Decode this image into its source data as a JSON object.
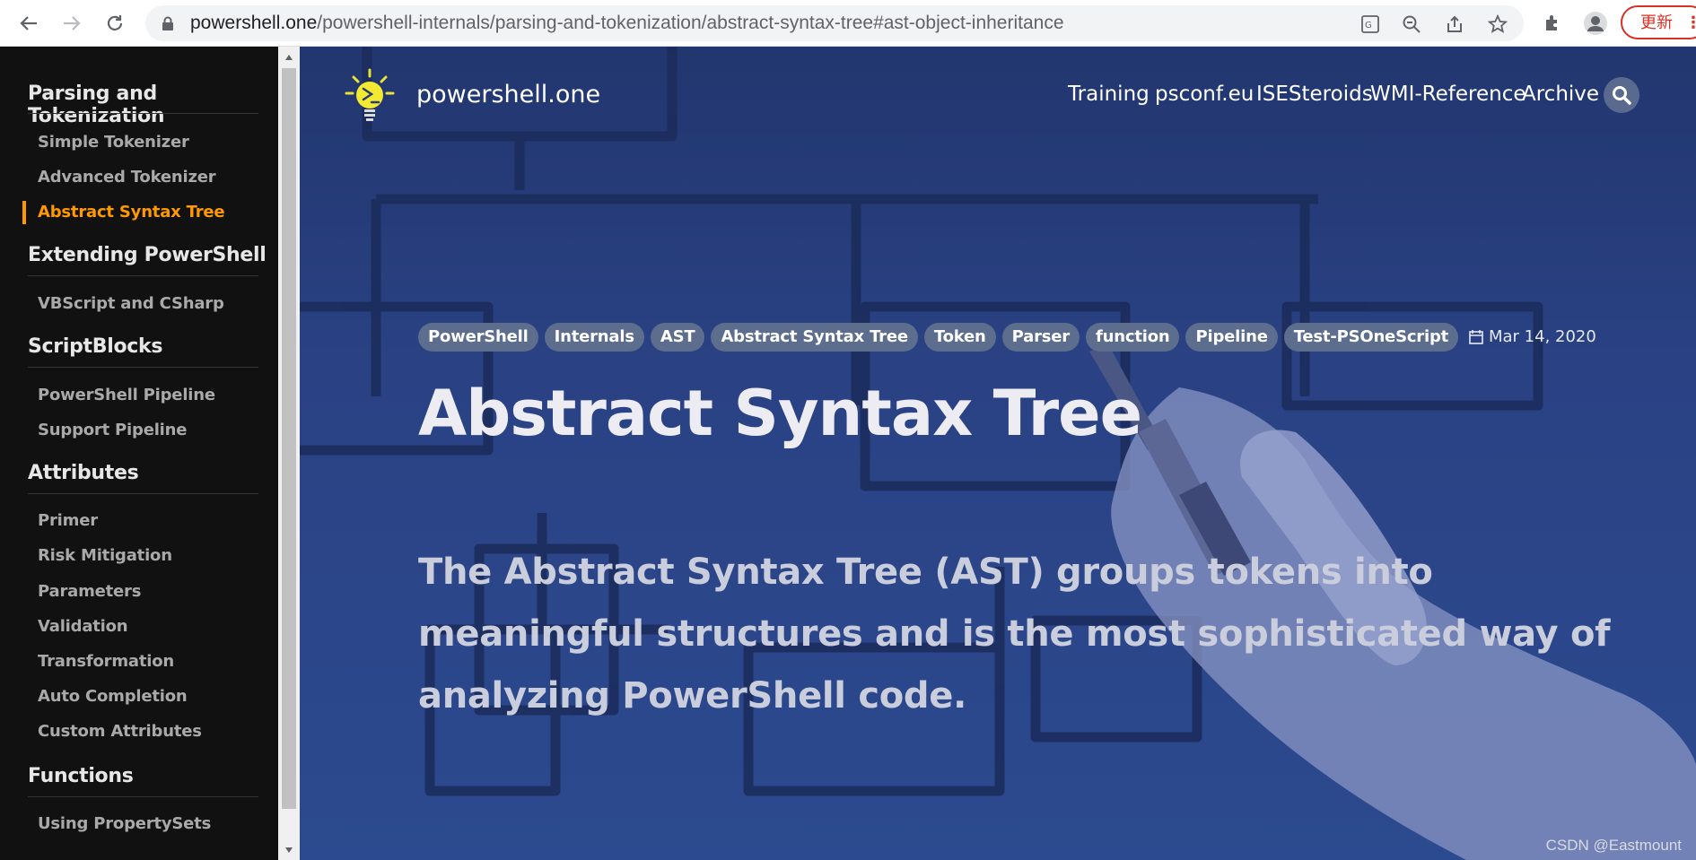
{
  "browser": {
    "url_host": "powershell.one",
    "url_path": "/powershell-internals/parsing-and-tokenization/abstract-syntax-tree#ast-object-inheritance",
    "update_label": "更新"
  },
  "sidebar": {
    "sections": [
      {
        "title": "Parsing and Tokenization",
        "items": [
          "Simple Tokenizer",
          "Advanced Tokenizer",
          "Abstract Syntax Tree"
        ]
      },
      {
        "title": "Extending PowerShell",
        "items": [
          "VBScript and CSharp"
        ]
      },
      {
        "title": "ScriptBlocks",
        "items": [
          "PowerShell Pipeline",
          "Support Pipeline"
        ]
      },
      {
        "title": "Attributes",
        "items": [
          "Primer",
          "Risk Mitigation",
          "Parameters",
          "Validation",
          "Transformation",
          "Auto Completion",
          "Custom Attributes"
        ]
      },
      {
        "title": "Functions",
        "items": [
          "Using PropertySets"
        ]
      }
    ],
    "active_item": "Abstract Syntax Tree"
  },
  "site": {
    "name": "powershell.one",
    "nav": [
      "Training",
      "psconf.eu",
      "ISESteroids",
      "WMI-Reference",
      "Archive"
    ]
  },
  "article": {
    "tags": [
      "PowerShell",
      "Internals",
      "AST",
      "Abstract Syntax Tree",
      "Token",
      "Parser",
      "function",
      "Pipeline",
      "Test-PSOneScript"
    ],
    "date": "Mar 14, 2020",
    "title": "Abstract Syntax Tree",
    "lead": "The Abstract Syntax Tree (AST) groups tokens into meaningful structures and is the most sophisticated way of analyzing PowerShell code."
  },
  "watermark": "CSDN @Eastmount",
  "colors": {
    "accent": "#ff9900",
    "hero_bg": "#22366f",
    "sidebar_bg": "#111111"
  }
}
